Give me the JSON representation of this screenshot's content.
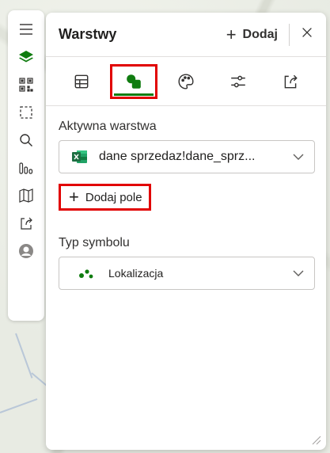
{
  "rail": {
    "items": [
      {
        "name": "menu-icon"
      },
      {
        "name": "layers-icon"
      },
      {
        "name": "qr-code-icon"
      },
      {
        "name": "select-area-icon"
      },
      {
        "name": "search-icon"
      },
      {
        "name": "chart-icon"
      },
      {
        "name": "map-icon"
      },
      {
        "name": "share-icon"
      },
      {
        "name": "avatar-icon"
      }
    ]
  },
  "panel": {
    "title": "Warstwy",
    "add_label": "Dodaj",
    "tabs": [
      {
        "name": "table-icon",
        "active": false
      },
      {
        "name": "shapes-icon",
        "active": true
      },
      {
        "name": "palette-icon",
        "active": false
      },
      {
        "name": "sliders-icon",
        "active": false
      },
      {
        "name": "export-icon",
        "active": false
      }
    ],
    "active_layer_label": "Aktywna warstwa",
    "active_layer_value": "dane sprzedaz!dane_sprz...",
    "add_field_label": "Dodaj pole",
    "symbol_type_label": "Typ symbolu",
    "symbol_type_value": "Lokalizacja"
  },
  "colors": {
    "accent_green": "#107c10",
    "highlight_red": "#e10000",
    "excel_green": "#1d6f42"
  }
}
